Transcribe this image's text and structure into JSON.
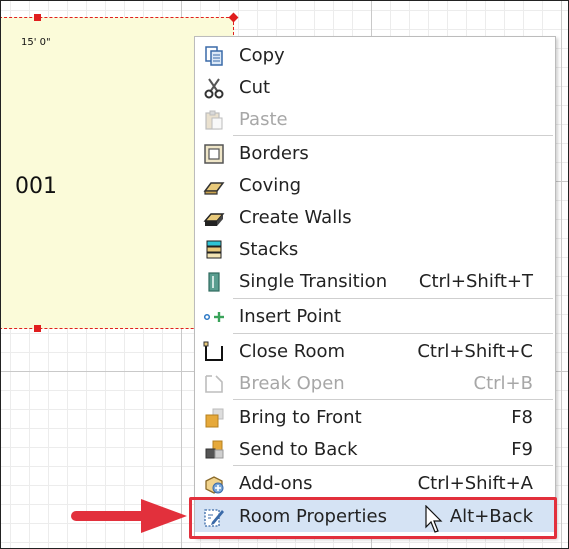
{
  "room": {
    "dimension_label": "15' 0\"",
    "number": "001"
  },
  "context_menu": {
    "items": [
      {
        "label": "Copy",
        "shortcut": "",
        "icon": "copy-icon",
        "disabled": false
      },
      {
        "label": "Cut",
        "shortcut": "",
        "icon": "scissors-icon",
        "disabled": false
      },
      {
        "label": "Paste",
        "shortcut": "",
        "icon": "paste-icon",
        "disabled": true
      },
      {
        "label": "Borders",
        "shortcut": "",
        "icon": "borders-icon",
        "disabled": false
      },
      {
        "label": "Coving",
        "shortcut": "",
        "icon": "coving-icon",
        "disabled": false
      },
      {
        "label": "Create Walls",
        "shortcut": "",
        "icon": "create-walls-icon",
        "disabled": false
      },
      {
        "label": "Stacks",
        "shortcut": "",
        "icon": "stacks-icon",
        "disabled": false
      },
      {
        "label": "Single Transition",
        "shortcut": "Ctrl+Shift+T",
        "icon": "transition-icon",
        "disabled": false
      },
      {
        "label": "Insert Point",
        "shortcut": "",
        "icon": "insert-point-icon",
        "disabled": false
      },
      {
        "label": "Close Room",
        "shortcut": "Ctrl+Shift+C",
        "icon": "close-room-icon",
        "disabled": false
      },
      {
        "label": "Break Open",
        "shortcut": "Ctrl+B",
        "icon": "break-open-icon",
        "disabled": true
      },
      {
        "label": "Bring to Front",
        "shortcut": "F8",
        "icon": "bring-front-icon",
        "disabled": false
      },
      {
        "label": "Send to Back",
        "shortcut": "F9",
        "icon": "send-back-icon",
        "disabled": false
      },
      {
        "label": "Add-ons",
        "shortcut": "Ctrl+Shift+A",
        "icon": "addons-icon",
        "disabled": false
      },
      {
        "label": "Room Properties",
        "shortcut": "Alt+Back",
        "icon": "room-properties-icon",
        "disabled": false,
        "highlighted": true
      }
    ]
  },
  "colors": {
    "highlight_border": "#e2303c",
    "arrow": "#e2303c",
    "room_fill": "#fbfbd9",
    "selection": "#d5e3f4"
  }
}
